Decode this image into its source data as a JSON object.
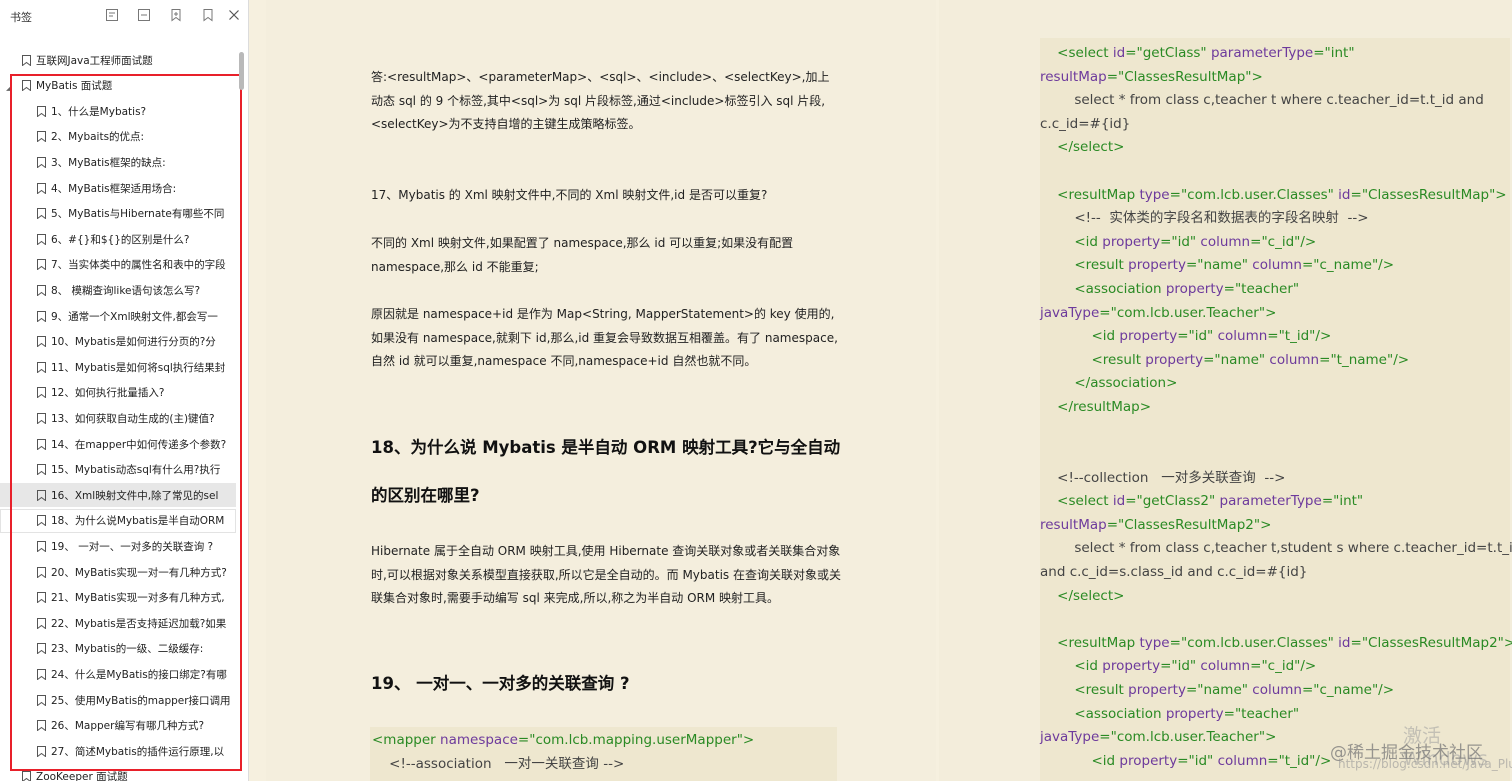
{
  "sidebar": {
    "title": "书签",
    "tree": [
      {
        "label": "互联网Java工程师面试题",
        "level": 0
      },
      {
        "label": "MyBatis 面试题",
        "level": 0
      },
      {
        "label": "1、什么是Mybatis?",
        "level": 1
      },
      {
        "label": "2、Mybaits的优点:",
        "level": 1
      },
      {
        "label": "3、MyBatis框架的缺点:",
        "level": 1
      },
      {
        "label": "4、MyBatis框架适用场合:",
        "level": 1
      },
      {
        "label": "5、MyBatis与Hibernate有哪些不同",
        "level": 1
      },
      {
        "label": "6、#{}和${}的区别是什么?",
        "level": 1
      },
      {
        "label": "7、当实体类中的属性名和表中的字段",
        "level": 1
      },
      {
        "label": "8、 模糊查询like语句该怎么写?",
        "level": 1
      },
      {
        "label": "9、通常一个Xml映射文件,都会写一",
        "level": 1
      },
      {
        "label": "10、Mybatis是如何进行分页的?分",
        "level": 1
      },
      {
        "label": "11、Mybatis是如何将sql执行结果封",
        "level": 1
      },
      {
        "label": "12、如何执行批量插入?",
        "level": 1
      },
      {
        "label": "13、如何获取自动生成的(主)键值?",
        "level": 1
      },
      {
        "label": "14、在mapper中如何传递多个参数?",
        "level": 1
      },
      {
        "label": "15、Mybatis动态sql有什么用?执行",
        "level": 1
      },
      {
        "label": "16、Xml映射文件中,除了常见的sel",
        "level": 1,
        "state": "selected"
      },
      {
        "label": "18、为什么说Mybatis是半自动ORM",
        "level": 1,
        "state": "hover"
      },
      {
        "label": "19、 一对一、一对多的关联查询 ?",
        "level": 1
      },
      {
        "label": "20、MyBatis实现一对一有几种方式?",
        "level": 1
      },
      {
        "label": "21、MyBatis实现一对多有几种方式,",
        "level": 1
      },
      {
        "label": "22、Mybatis是否支持延迟加载?如果",
        "level": 1
      },
      {
        "label": "23、Mybatis的一级、二级缓存:",
        "level": 1
      },
      {
        "label": "24、什么是MyBatis的接口绑定?有哪",
        "level": 1
      },
      {
        "label": "25、使用MyBatis的mapper接口调用",
        "level": 1
      },
      {
        "label": "26、Mapper编写有哪几种方式?",
        "level": 1
      },
      {
        "label": "27、简述Mybatis的插件运行原理,以",
        "level": 1
      },
      {
        "label": "ZooKeeper 面试题",
        "level": 0
      }
    ]
  },
  "doc_left": {
    "p1": "答:<resultMap>、<parameterMap>、<sql>、<include>、<selectKey>,加上动态 sql 的 9 个标签,其中<sql>为 sql 片段标签,通过<include>标签引入 sql 片段,<selectKey>为不支持自增的主键生成策略标签。",
    "p2": "17、Mybatis 的 Xml 映射文件中,不同的 Xml 映射文件,id 是否可以重复?",
    "p3": "不同的 Xml 映射文件,如果配置了 namespace,那么 id 可以重复;如果没有配置 namespace,那么 id 不能重复;",
    "p4": "原因就是 namespace+id 是作为 Map<String, MapperStatement>的 key 使用的,如果没有 namespace,就剩下 id,那么,id 重复会导致数据互相覆盖。有了 namespace,自然 id 就可以重复,namespace 不同,namespace+id 自然也就不同。",
    "h18_line1": "18、为什么说 Mybatis 是半自动 ORM 映射工具?它与全自动",
    "h18_line2": "的区别在哪里?",
    "p5": "Hibernate 属于全自动 ORM 映射工具,使用 Hibernate 查询关联对象或者关联集合对象时,可以根据对象关系模型直接获取,所以它是全自动的。而 Mybatis 在查询关联对象或关联集合对象时,需要手动编写 sql 来完成,所以,称之为半自动 ORM 映射工具。",
    "h19": "19、 一对一、一对多的关联查询 ?",
    "code_lines": [
      [
        [
          "tag",
          "<mapper "
        ],
        [
          "attr",
          "namespace"
        ],
        [
          "tag",
          "="
        ],
        [
          "val",
          "\"com.lcb.mapping.userMapper\""
        ],
        [
          "tag",
          ">"
        ]
      ],
      [
        [
          "cmt",
          "    <!--association   一对一关联查询 -->"
        ]
      ]
    ]
  },
  "doc_right": {
    "code_lines": [
      [
        [
          "tag",
          "    <select "
        ],
        [
          "attr",
          "id"
        ],
        [
          "tag",
          "="
        ],
        [
          "val",
          "\"getClass\""
        ],
        [
          "tag",
          " "
        ],
        [
          "attr",
          "parameterType"
        ],
        [
          "tag",
          "="
        ],
        [
          "val",
          "\"int\""
        ]
      ],
      [
        [
          "attr",
          "resultMap"
        ],
        [
          "tag",
          "="
        ],
        [
          "val",
          "\"ClassesResultMap\""
        ],
        [
          "tag",
          ">"
        ]
      ],
      [
        [
          "cmt",
          "        select * from class c,teacher t where c.teacher_id=t.t_id and"
        ]
      ],
      [
        [
          "cmt",
          "c.c_id=#{id}"
        ]
      ],
      [
        [
          "tag",
          "    </select>"
        ]
      ],
      [
        [
          "cmt",
          ""
        ]
      ],
      [
        [
          "tag",
          "    <resultMap "
        ],
        [
          "attr",
          "type"
        ],
        [
          "tag",
          "="
        ],
        [
          "val",
          "\"com.lcb.user.Classes\""
        ],
        [
          "tag",
          " "
        ],
        [
          "attr",
          "id"
        ],
        [
          "tag",
          "="
        ],
        [
          "val",
          "\"ClassesResultMap\""
        ],
        [
          "tag",
          ">"
        ]
      ],
      [
        [
          "cmt",
          "        <!--  实体类的字段名和数据表的字段名映射  -->"
        ]
      ],
      [
        [
          "tag",
          "        <id "
        ],
        [
          "attr",
          "property"
        ],
        [
          "tag",
          "="
        ],
        [
          "val",
          "\"id\""
        ],
        [
          "tag",
          " "
        ],
        [
          "attr",
          "column"
        ],
        [
          "tag",
          "="
        ],
        [
          "val",
          "\"c_id\""
        ],
        [
          "tag",
          "/>"
        ]
      ],
      [
        [
          "tag",
          "        <result "
        ],
        [
          "attr",
          "property"
        ],
        [
          "tag",
          "="
        ],
        [
          "val",
          "\"name\""
        ],
        [
          "tag",
          " "
        ],
        [
          "attr",
          "column"
        ],
        [
          "tag",
          "="
        ],
        [
          "val",
          "\"c_name\""
        ],
        [
          "tag",
          "/>"
        ]
      ],
      [
        [
          "tag",
          "        <association "
        ],
        [
          "attr",
          "property"
        ],
        [
          "tag",
          "="
        ],
        [
          "val",
          "\"teacher\""
        ]
      ],
      [
        [
          "attr",
          "javaType"
        ],
        [
          "tag",
          "="
        ],
        [
          "val",
          "\"com.lcb.user.Teacher\""
        ],
        [
          "tag",
          ">"
        ]
      ],
      [
        [
          "tag",
          "            <id "
        ],
        [
          "attr",
          "property"
        ],
        [
          "tag",
          "="
        ],
        [
          "val",
          "\"id\""
        ],
        [
          "tag",
          " "
        ],
        [
          "attr",
          "column"
        ],
        [
          "tag",
          "="
        ],
        [
          "val",
          "\"t_id\""
        ],
        [
          "tag",
          "/>"
        ]
      ],
      [
        [
          "tag",
          "            <result "
        ],
        [
          "attr",
          "property"
        ],
        [
          "tag",
          "="
        ],
        [
          "val",
          "\"name\""
        ],
        [
          "tag",
          " "
        ],
        [
          "attr",
          "column"
        ],
        [
          "tag",
          "="
        ],
        [
          "val",
          "\"t_name\""
        ],
        [
          "tag",
          "/>"
        ]
      ],
      [
        [
          "tag",
          "        </association>"
        ]
      ],
      [
        [
          "tag",
          "    </resultMap>"
        ]
      ],
      [
        [
          "cmt",
          ""
        ]
      ],
      [
        [
          "cmt",
          ""
        ]
      ],
      [
        [
          "cmt",
          "    <!--collection   一对多关联查询  -->"
        ]
      ],
      [
        [
          "tag",
          "    <select "
        ],
        [
          "attr",
          "id"
        ],
        [
          "tag",
          "="
        ],
        [
          "val",
          "\"getClass2\""
        ],
        [
          "tag",
          " "
        ],
        [
          "attr",
          "parameterType"
        ],
        [
          "tag",
          "="
        ],
        [
          "val",
          "\"int\""
        ]
      ],
      [
        [
          "attr",
          "resultMap"
        ],
        [
          "tag",
          "="
        ],
        [
          "val",
          "\"ClassesResultMap2\""
        ],
        [
          "tag",
          ">"
        ]
      ],
      [
        [
          "cmt",
          "        select * from class c,teacher t,student s where c.teacher_id=t.t_id"
        ]
      ],
      [
        [
          "cmt",
          "and c.c_id=s.class_id and c.c_id=#{id}"
        ]
      ],
      [
        [
          "tag",
          "    </select>"
        ]
      ],
      [
        [
          "cmt",
          ""
        ]
      ],
      [
        [
          "tag",
          "    <resultMap "
        ],
        [
          "attr",
          "type"
        ],
        [
          "tag",
          "="
        ],
        [
          "val",
          "\"com.lcb.user.Classes\""
        ],
        [
          "tag",
          " "
        ],
        [
          "attr",
          "id"
        ],
        [
          "tag",
          "="
        ],
        [
          "val",
          "\"ClassesResultMap2\""
        ],
        [
          "tag",
          ">"
        ]
      ],
      [
        [
          "tag",
          "        <id "
        ],
        [
          "attr",
          "property"
        ],
        [
          "tag",
          "="
        ],
        [
          "val",
          "\"id\""
        ],
        [
          "tag",
          " "
        ],
        [
          "attr",
          "column"
        ],
        [
          "tag",
          "="
        ],
        [
          "val",
          "\"c_id\""
        ],
        [
          "tag",
          "/>"
        ]
      ],
      [
        [
          "tag",
          "        <result "
        ],
        [
          "attr",
          "property"
        ],
        [
          "tag",
          "="
        ],
        [
          "val",
          "\"name\""
        ],
        [
          "tag",
          " "
        ],
        [
          "attr",
          "column"
        ],
        [
          "tag",
          "="
        ],
        [
          "val",
          "\"c_name\""
        ],
        [
          "tag",
          "/>"
        ]
      ],
      [
        [
          "tag",
          "        <association "
        ],
        [
          "attr",
          "property"
        ],
        [
          "tag",
          "="
        ],
        [
          "val",
          "\"teacher\""
        ]
      ],
      [
        [
          "attr",
          "javaType"
        ],
        [
          "tag",
          "="
        ],
        [
          "val",
          "\"com.lcb.user.Teacher\""
        ],
        [
          "tag",
          ">"
        ]
      ],
      [
        [
          "tag",
          "            <id "
        ],
        [
          "attr",
          "property"
        ],
        [
          "tag",
          "="
        ],
        [
          "val",
          "\"id\""
        ],
        [
          "tag",
          " "
        ],
        [
          "attr",
          "column"
        ],
        [
          "tag",
          "="
        ],
        [
          "val",
          "\"t_id\""
        ],
        [
          "tag",
          "/>"
        ]
      ]
    ]
  },
  "watermarks": {
    "activate": "激活 Windows",
    "juejin": "@稀土掘金技术社区",
    "url": "https://blog.csdn.net/Java_Pluto"
  },
  "colors": {
    "highlight_box": "#e8202a",
    "code_tag": "#2a8a24",
    "code_attr": "#6d3a9c",
    "page_bg": "#f6f0df"
  }
}
